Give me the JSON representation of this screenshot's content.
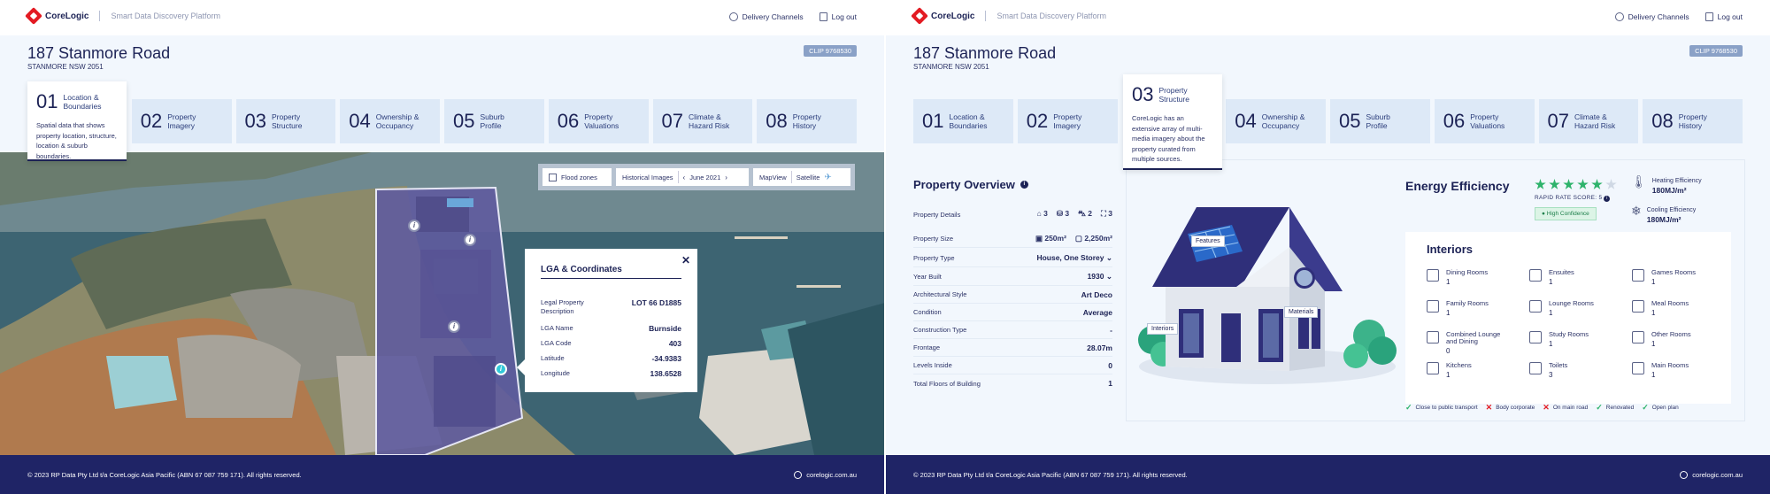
{
  "left": {
    "header": {
      "brand": "CoreLogic",
      "platform": "Smart Data Discovery Platform",
      "delivery": "Delivery Channels",
      "logout": "Log out"
    },
    "address": {
      "title": "187 Stanmore Road",
      "suburb": "STANMORE NSW 2051",
      "clip": "CLIP 9768530"
    },
    "steps": [
      {
        "num": "01",
        "label": "Location & Boundaries",
        "desc": "Spatial data that shows property location, structure, location & suburb boundaries."
      },
      {
        "num": "02",
        "label": "Property Imagery"
      },
      {
        "num": "03",
        "label": "Property Structure"
      },
      {
        "num": "04",
        "label": "Ownership & Occupancy"
      },
      {
        "num": "05",
        "label": "Suburb Profile"
      },
      {
        "num": "06",
        "label": "Property Valuations"
      },
      {
        "num": "07",
        "label": "Climate & Hazard Risk"
      },
      {
        "num": "08",
        "label": "Property History"
      }
    ],
    "controls": {
      "flood": "Flood zones",
      "historical": "Historical Images",
      "date": "June 2021",
      "mapview": "MapView",
      "satellite": "Satellite"
    },
    "lga": {
      "title": "LGA & Coordinates",
      "rows": [
        {
          "k": "Legal Property Description",
          "v": "LOT 66 D1885"
        },
        {
          "k": "LGA Name",
          "v": "Burnside"
        },
        {
          "k": "LGA Code",
          "v": "403"
        },
        {
          "k": "Latitude",
          "v": "-34.9383"
        },
        {
          "k": "Longitude",
          "v": "138.6528"
        }
      ]
    },
    "footer": {
      "copy": "© 2023 RP Data Pty Ltd t/a CoreLogic Asia Pacific (ABN 67 087 759 171). All rights reserved.",
      "site": "corelogic.com.au"
    }
  },
  "right": {
    "header": {
      "brand": "CoreLogic",
      "platform": "Smart Data Discovery Platform",
      "delivery": "Delivery Channels",
      "logout": "Log out"
    },
    "address": {
      "title": "187 Stanmore Road",
      "suburb": "STANMORE NSW 2051",
      "clip": "CLIP 9768530"
    },
    "steps": [
      {
        "num": "01",
        "label": "Location & Boundaries"
      },
      {
        "num": "02",
        "label": "Property Imagery"
      },
      {
        "num": "03",
        "label": "Property Structure",
        "desc": "CoreLogic has an extensive array of multi-media imagery about the property curated from multiple sources."
      },
      {
        "num": "04",
        "label": "Ownership & Occupancy"
      },
      {
        "num": "05",
        "label": "Suburb Profile"
      },
      {
        "num": "06",
        "label": "Property Valuations"
      },
      {
        "num": "07",
        "label": "Climate & Hazard Risk"
      },
      {
        "num": "08",
        "label": "Property History"
      }
    ],
    "overview": {
      "title": "Property Overview",
      "details_label": "Property Details",
      "beds": "3",
      "baths": "3",
      "cars": "2",
      "lounges": "3",
      "size_label": "Property Size",
      "floor": "250m²",
      "land": "2,250m²",
      "rows": [
        {
          "k": "Property Type",
          "v": "House, One Storey"
        },
        {
          "k": "Year Built",
          "v": "1930"
        },
        {
          "k": "Architectural Style",
          "v": "Art Deco"
        },
        {
          "k": "Condition",
          "v": "Average"
        },
        {
          "k": "Construction Type",
          "v": "-"
        },
        {
          "k": "Frontage",
          "v": "28.07m"
        },
        {
          "k": "Levels Inside",
          "v": "0"
        },
        {
          "k": "Total Floors of Building",
          "v": "1"
        }
      ]
    },
    "house_labels": {
      "features": "Features",
      "materials": "Materials",
      "interiors": "Interiors"
    },
    "energy": {
      "title": "Energy Efficiency",
      "rating": 5,
      "rating_max": 6,
      "rapid": "RAPID RATE SCORE: 5",
      "confidence": "High Confidence",
      "heating_label": "Heating Efficiency",
      "heating": "180MJ/m²",
      "cooling_label": "Cooling Efficiency",
      "cooling": "180MJ/m²"
    },
    "interiors": {
      "title": "Interiors",
      "items": [
        {
          "label": "Dining Rooms",
          "n": "1"
        },
        {
          "label": "Ensuites",
          "n": "1"
        },
        {
          "label": "Games Rooms",
          "n": "1"
        },
        {
          "label": "Family Rooms",
          "n": "1"
        },
        {
          "label": "Lounge Rooms",
          "n": "1"
        },
        {
          "label": "Meal Rooms",
          "n": "1"
        },
        {
          "label": "Combined Lounge and Dining",
          "n": "0"
        },
        {
          "label": "Study Rooms",
          "n": "1"
        },
        {
          "label": "Other Rooms",
          "n": "1"
        },
        {
          "label": "Kitchens",
          "n": "1"
        },
        {
          "label": "Toilets",
          "n": "3"
        },
        {
          "label": "Main Rooms",
          "n": "1"
        }
      ]
    },
    "tags": [
      {
        "label": "Close to public transport",
        "ok": true
      },
      {
        "label": "Body corporate",
        "ok": false
      },
      {
        "label": "On main road",
        "ok": false
      },
      {
        "label": "Renovated",
        "ok": true
      },
      {
        "label": "Open plan",
        "ok": true
      }
    ],
    "footer": {
      "copy": "© 2023 RP Data Pty Ltd t/a CoreLogic Asia Pacific (ABN 67 087 759 171). All rights reserved.",
      "site": "corelogic.com.au"
    }
  }
}
